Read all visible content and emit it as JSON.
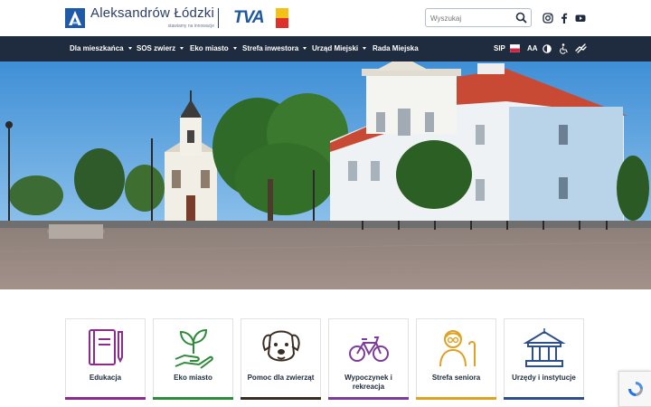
{
  "brand": {
    "name": "Aleksandrów Łódzki",
    "tagline": "stawiamy na innowacje",
    "tva_label": "TVA"
  },
  "search": {
    "placeholder": "Wyszukaj",
    "value": ""
  },
  "social": [
    {
      "icon": "instagram-icon"
    },
    {
      "icon": "facebook-icon"
    },
    {
      "icon": "youtube-icon"
    }
  ],
  "nav": {
    "items": [
      {
        "label": "Dla mieszkańca",
        "has_dropdown": true
      },
      {
        "label": "SOS zwierz",
        "has_dropdown": true
      },
      {
        "label": "Eko miasto",
        "has_dropdown": true
      },
      {
        "label": "Strefa inwestora",
        "has_dropdown": true
      },
      {
        "label": "Urząd Miejski",
        "has_dropdown": true
      },
      {
        "label": "Rada Miejska",
        "has_dropdown": false
      }
    ],
    "tools": {
      "sip": "SIP",
      "font_size": "AA",
      "contrast_icon": "contrast-icon",
      "accessibility_icon": "wheelchair-icon",
      "sign_language_icon": "sign-language-icon",
      "flag_icon": "poland-flag-icon"
    }
  },
  "hero": {
    "image": "town-square-photo"
  },
  "tiles": [
    {
      "label": "Edukacja",
      "icon": "book-icon",
      "color": "#8e2a8e"
    },
    {
      "label": "Eko miasto",
      "icon": "plant-hand-icon",
      "color": "#2e8b3a"
    },
    {
      "label": "Pomoc dla zwierząt",
      "icon": "dog-icon",
      "color": "#3a2e24"
    },
    {
      "label": "Wypoczynek i rekreacja",
      "icon": "bicycle-icon",
      "color": "#7b3c9a"
    },
    {
      "label": "Strefa seniora",
      "icon": "senior-icon",
      "color": "#e0a020"
    },
    {
      "label": "Urzędy i instytucje",
      "icon": "building-icon",
      "color": "#2d4f8a"
    }
  ],
  "colors": {
    "nav_bg": "#1f2b3e",
    "brand_blue": "#2c3e66"
  }
}
